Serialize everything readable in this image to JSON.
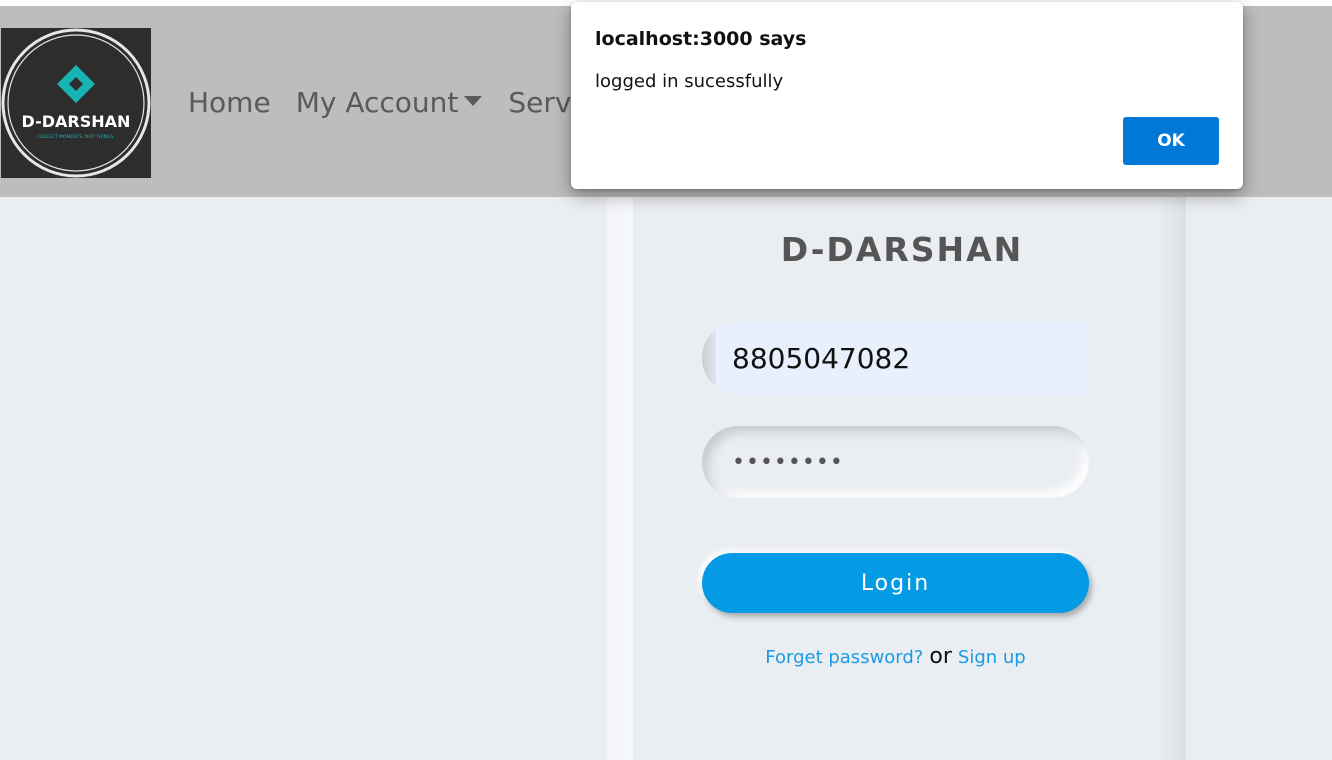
{
  "logo": {
    "brand_name": "D-DARSHAN",
    "tagline": "COLLECT MOMENTS, NOT THINGS."
  },
  "nav": {
    "items": [
      {
        "label": "Home"
      },
      {
        "label": "My Account"
      },
      {
        "label": "Servic"
      }
    ]
  },
  "login_card": {
    "title": "D-DARSHAN",
    "phone_value": "8805047082",
    "password_value": "abcdefgh",
    "login_label": "Login",
    "forget_label": "Forget password?",
    "or_label": "or",
    "signup_label": "Sign up"
  },
  "dialog": {
    "title": "localhost:3000 says",
    "message": "logged in sucessfully",
    "ok_label": "OK"
  },
  "colors": {
    "navbar": "#bdbdbd",
    "background": "#eaedf1",
    "accent": "#049be4",
    "link": "#1a9be3",
    "dialog_button": "#0078d7",
    "logo_teal": "#1ab3b3"
  }
}
